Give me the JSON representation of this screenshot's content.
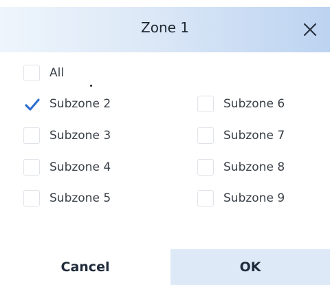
{
  "dialog": {
    "title": "Zone 1",
    "close_icon": "close-icon"
  },
  "options": [
    {
      "id": "all",
      "label": "All",
      "checked": false
    },
    {
      "id": "subzone-2",
      "label": "Subzone 2",
      "checked": true
    },
    {
      "id": "subzone-3",
      "label": "Subzone 3",
      "checked": false
    },
    {
      "id": "subzone-4",
      "label": "Subzone 4",
      "checked": false
    },
    {
      "id": "subzone-5",
      "label": "Subzone 5",
      "checked": false
    },
    {
      "id": "subzone-6",
      "label": "Subzone 6",
      "checked": false
    },
    {
      "id": "subzone-7",
      "label": "Subzone 7",
      "checked": false
    },
    {
      "id": "subzone-8",
      "label": "Subzone 8",
      "checked": false
    },
    {
      "id": "subzone-9",
      "label": "Subzone 9",
      "checked": false
    }
  ],
  "footer": {
    "cancel_label": "Cancel",
    "ok_label": "OK"
  },
  "colors": {
    "check": "#2f6fd0",
    "header_gradient_start": "#eef5fc",
    "header_gradient_end": "#bcd3f1",
    "ok_background": "#dde9f7"
  }
}
